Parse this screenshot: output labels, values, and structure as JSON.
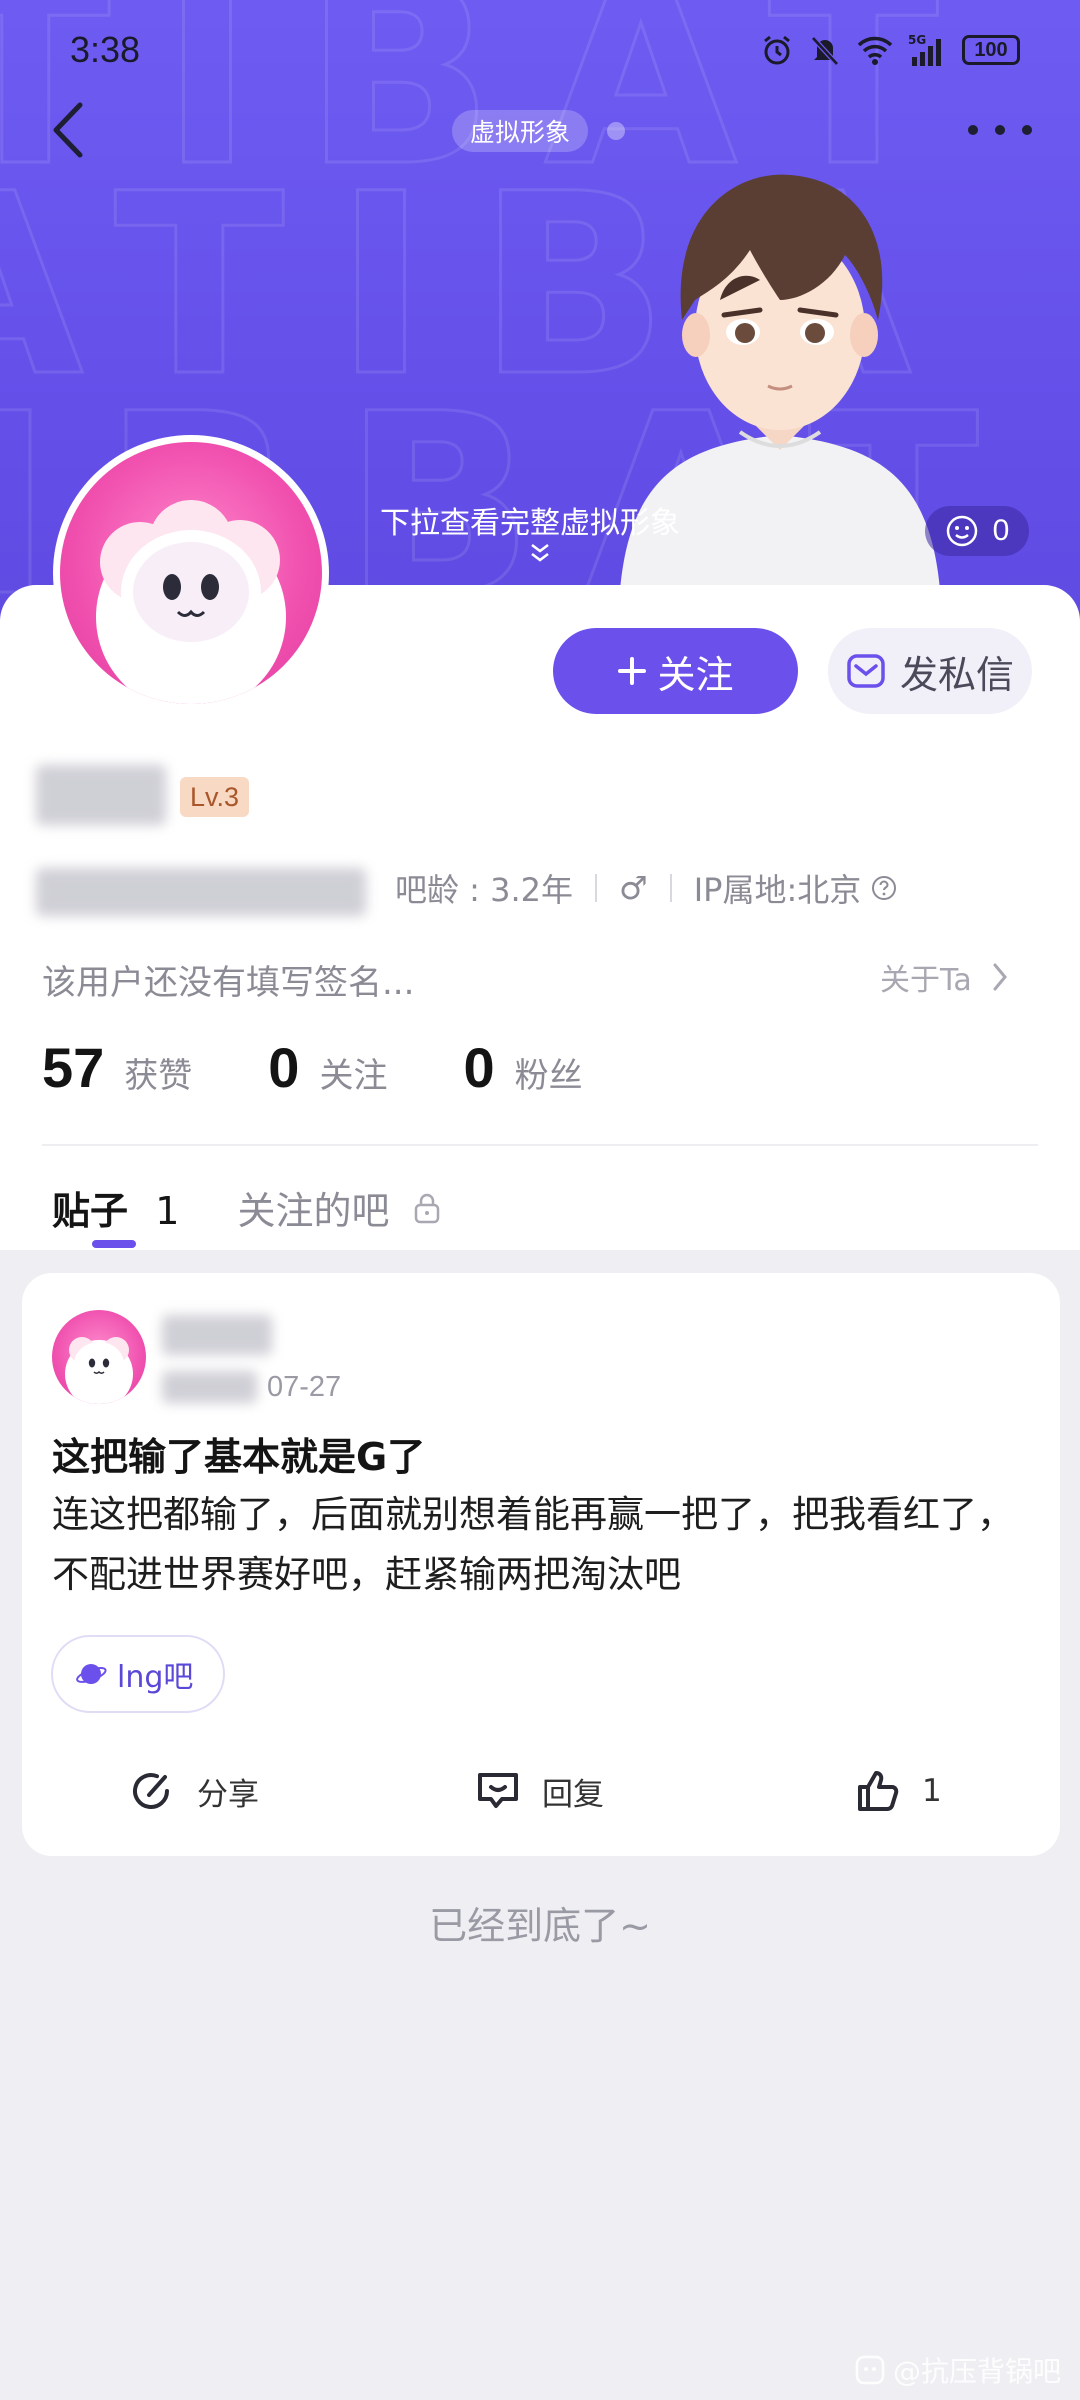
{
  "status_bar": {
    "time": "3:38",
    "signal": "5G",
    "battery": "100"
  },
  "header": {
    "tag": "虚拟形象",
    "pull_hint": "下拉查看完整虚拟形象",
    "like_count": "0"
  },
  "profile": {
    "follow_label": "关注",
    "message_label": "发私信",
    "level": "Lv.3",
    "age": "吧龄 : 3.2年",
    "gender_symbol": "♂",
    "ip": "IP属地:北京",
    "signature": "该用户还没有填写签名...",
    "about": "关于Ta",
    "stats": [
      {
        "value": "57",
        "label": "获赞"
      },
      {
        "value": "0",
        "label": "关注"
      },
      {
        "value": "0",
        "label": "粉丝"
      }
    ]
  },
  "tabs": {
    "posts_label": "贴子",
    "posts_count": "1",
    "followed_bars": "关注的吧"
  },
  "post": {
    "date": "07-27",
    "title": "这把输了基本就是G了",
    "body": "连这把都输了，后面就别想着能再赢一把了，把我看红了，不配进世界赛好吧，赶紧输两把淘汰吧",
    "forum": "lng吧",
    "share_label": "分享",
    "reply_label": "回复",
    "like_count": "1"
  },
  "end_text": "已经到底了~",
  "credit": "@抗压背锅吧",
  "colors": {
    "accent": "#6b50ec",
    "banner": "#6551ea",
    "level_bg": "#f8d9c4"
  }
}
